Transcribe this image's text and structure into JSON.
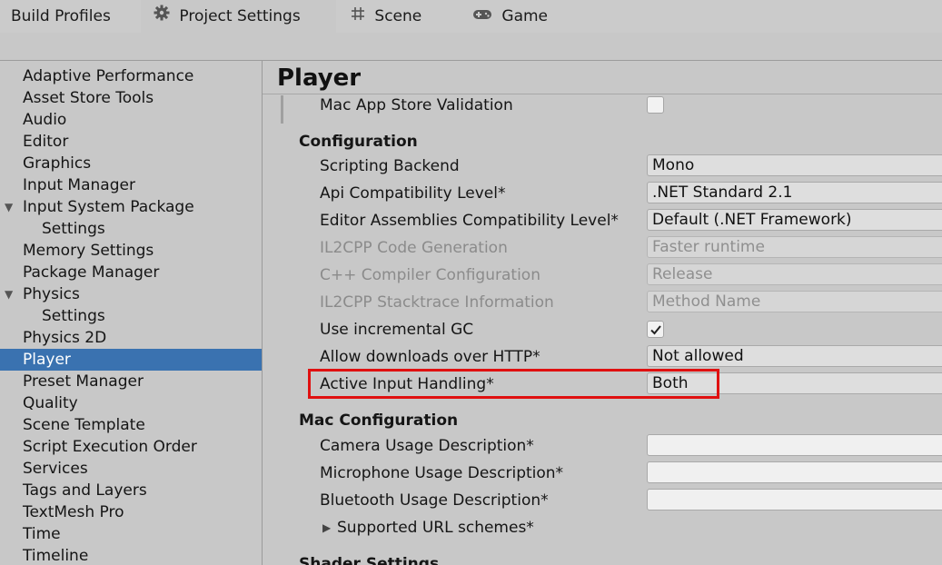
{
  "tabs": [
    {
      "label": "Build Profiles",
      "icon": ""
    },
    {
      "label": "Project Settings",
      "icon": "gear-icon"
    },
    {
      "label": "Scene",
      "icon": "hash-icon"
    },
    {
      "label": "Game",
      "icon": "gamepad-icon"
    }
  ],
  "sidebar": {
    "items": [
      {
        "label": "Adaptive Performance"
      },
      {
        "label": "Asset Store Tools"
      },
      {
        "label": "Audio"
      },
      {
        "label": "Editor"
      },
      {
        "label": "Graphics"
      },
      {
        "label": "Input Manager"
      },
      {
        "label": "Input System Package",
        "expanded": true
      },
      {
        "label": "Settings"
      },
      {
        "label": "Memory Settings"
      },
      {
        "label": "Package Manager"
      },
      {
        "label": "Physics",
        "expanded": true
      },
      {
        "label": "Settings"
      },
      {
        "label": "Physics 2D"
      },
      {
        "label": "Player",
        "selected": true
      },
      {
        "label": "Preset Manager"
      },
      {
        "label": "Quality"
      },
      {
        "label": "Scene Template"
      },
      {
        "label": "Script Execution Order"
      },
      {
        "label": "Services"
      },
      {
        "label": "Tags and Layers"
      },
      {
        "label": "TextMesh Pro"
      },
      {
        "label": "Time"
      },
      {
        "label": "Timeline"
      }
    ]
  },
  "main": {
    "title": "Player",
    "mac_app_store_validation": {
      "label": "Mac App Store Validation",
      "checked": false
    },
    "configuration": {
      "heading": "Configuration",
      "rows": [
        {
          "label": "Scripting Backend",
          "value": "Mono",
          "disabled": false
        },
        {
          "label": "Api Compatibility Level*",
          "value": ".NET Standard 2.1",
          "disabled": false
        },
        {
          "label": "Editor Assemblies Compatibility Level*",
          "value": "Default (.NET Framework)",
          "disabled": false
        },
        {
          "label": "IL2CPP Code Generation",
          "value": "Faster runtime",
          "disabled": true
        },
        {
          "label": "C++ Compiler Configuration",
          "value": "Release",
          "disabled": true
        },
        {
          "label": "IL2CPP Stacktrace Information",
          "value": "Method Name",
          "disabled": true
        }
      ],
      "incremental_gc": {
        "label": "Use incremental GC",
        "checked": true
      },
      "downloads_http": {
        "label": "Allow downloads over HTTP*",
        "value": "Not allowed"
      },
      "active_input": {
        "label": "Active Input Handling*",
        "value": "Both"
      }
    },
    "mac_configuration": {
      "heading": "Mac Configuration",
      "camera": {
        "label": "Camera Usage Description*",
        "value": ""
      },
      "microphone": {
        "label": "Microphone Usage Description*",
        "value": ""
      },
      "bluetooth": {
        "label": "Bluetooth Usage Description*",
        "value": ""
      },
      "url_schemes": {
        "label": "Supported URL schemes*"
      }
    },
    "shader_settings": {
      "heading": "Shader Settings"
    }
  },
  "colors": {
    "selection": "#3a72b0",
    "highlight_box": "#e01010"
  }
}
